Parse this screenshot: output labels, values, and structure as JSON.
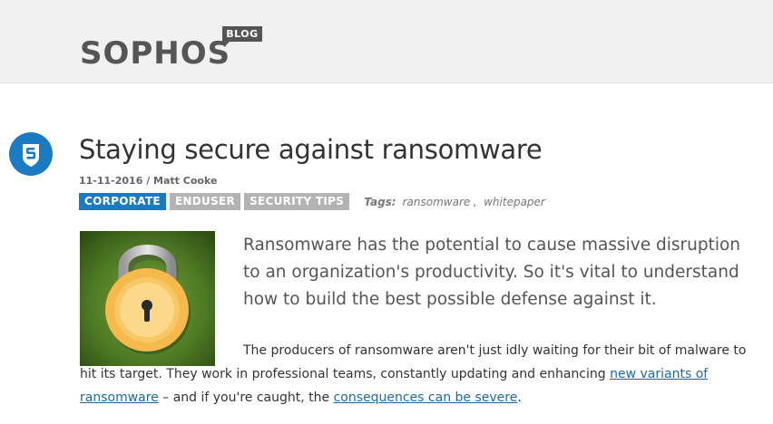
{
  "header": {
    "logo_text": "SOPHOS",
    "blog_tag": "BLOG"
  },
  "post": {
    "icon": "sophos-shield-icon",
    "title": "Staying secure against ransomware",
    "meta": "11-11-2016 / Matt Cooke",
    "categories": [
      "CORPORATE",
      "ENDUSER",
      "SECURITY TIPS"
    ],
    "tags_label": "Tags:",
    "tags": [
      "ransomware",
      "whitepaper"
    ],
    "tag_separator": ",",
    "thumbnail": "padlock-image",
    "lead": "Ransomware has the potential to cause massive disruption to an organization's productivity. So it's vital to understand how to build the best possible defense against it.",
    "body": {
      "part1": "The producers of ransomware aren't just idly waiting for their bit of malware to hit its target. They work in professional teams, constantly updating and enhancing ",
      "link1": "new variants of ransomware",
      "part2": " – and if you're caught, the ",
      "link2": "consequences can be severe",
      "part3": "."
    }
  },
  "colors": {
    "header_bg": "#f1f1f1",
    "brand_blue": "#1a7bc2",
    "tag_grey": "#b3b3b3",
    "link": "#1a6aa8"
  }
}
